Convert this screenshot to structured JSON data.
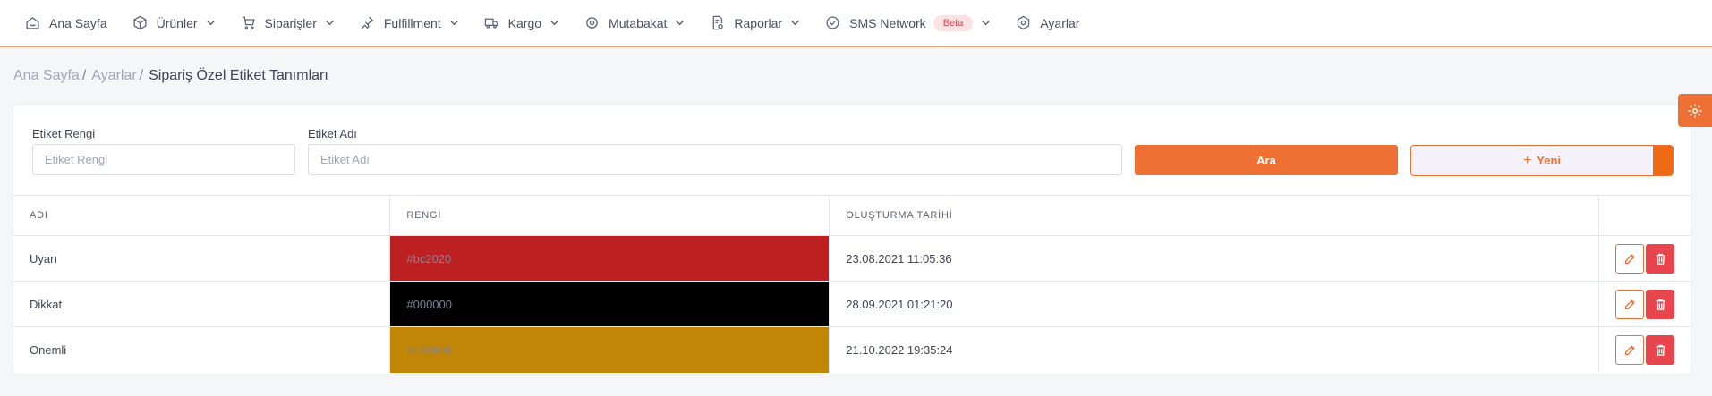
{
  "nav": {
    "items": [
      {
        "label": "Ana Sayfa",
        "icon": "home-icon",
        "dropdown": false
      },
      {
        "label": "Ürünler",
        "icon": "box-icon",
        "dropdown": true
      },
      {
        "label": "Siparişler",
        "icon": "cart-icon",
        "dropdown": true
      },
      {
        "label": "Fulfillment",
        "icon": "pin-icon",
        "dropdown": true
      },
      {
        "label": "Kargo",
        "icon": "truck-icon",
        "dropdown": true
      },
      {
        "label": "Mutabakat",
        "icon": "sync-icon",
        "dropdown": true
      },
      {
        "label": "Raporlar",
        "icon": "report-icon",
        "dropdown": true
      },
      {
        "label": "SMS Network",
        "icon": "check-circle-icon",
        "dropdown": true,
        "badge": "Beta"
      },
      {
        "label": "Ayarlar",
        "icon": "settings-icon",
        "dropdown": false
      }
    ]
  },
  "breadcrumb": {
    "items": [
      "Ana Sayfa",
      "Ayarlar"
    ],
    "separator": "/",
    "current": "Sipariş Özel Etiket Tanımları"
  },
  "filters": {
    "color_label": "Etiket Rengi",
    "color_placeholder": "Etiket Rengi",
    "color_value": "",
    "name_label": "Etiket Adı",
    "name_placeholder": "Etiket Adı",
    "name_value": ""
  },
  "buttons": {
    "search_label": "Ara",
    "new_label": "Yeni"
  },
  "table": {
    "headers": [
      "ADI",
      "RENGİ",
      "OLUŞTURMA TARİHİ",
      ""
    ],
    "rows": [
      {
        "name": "Uyarı",
        "color": "#bc2020",
        "created": "23.08.2021 11:05:36"
      },
      {
        "name": "Dikkat",
        "color": "#000000",
        "created": "28.09.2021 01:21:20"
      },
      {
        "name": "Onemli",
        "color": "#c18606",
        "created": "21.10.2022 19:35:24"
      }
    ]
  },
  "colors": {
    "accent": "#ef7035",
    "danger": "#e8464f",
    "badge_bg": "#fde2e4"
  }
}
